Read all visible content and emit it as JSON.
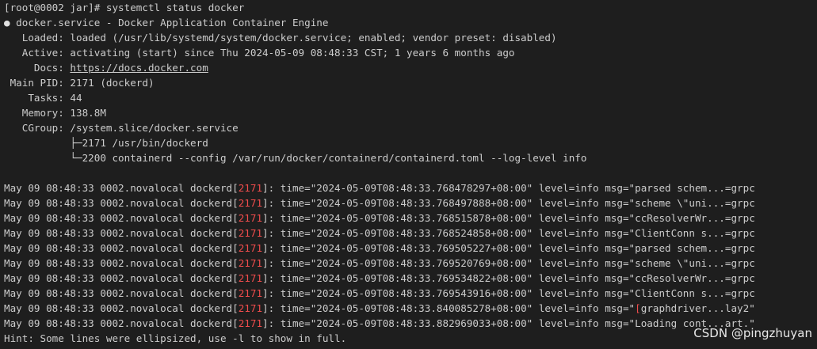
{
  "prompt": "[root@0002 jar]# systemctl status docker",
  "service": {
    "bullet": "●",
    "line": " docker.service - Docker Application Container Engine"
  },
  "fields": [
    {
      "label": "   Loaded: ",
      "value": "loaded (/usr/lib/systemd/system/docker.service; enabled; vendor preset: disabled)"
    },
    {
      "label": "   Active: ",
      "value": "activating (start) since Thu 2024-05-09 08:48:33 CST; 1 years 6 months ago"
    },
    {
      "label": "     Docs: ",
      "value": "https://docs.docker.com"
    },
    {
      "label": " Main PID: ",
      "value": "2171 (dockerd)"
    },
    {
      "label": "    Tasks: ",
      "value": "44"
    },
    {
      "label": "   Memory: ",
      "value": "138.8M"
    },
    {
      "label": "   CGroup: ",
      "value": "/system.slice/docker.service"
    }
  ],
  "cgroup_tree": [
    "           ├─2171 /usr/bin/dockerd",
    "           └─2200 containerd --config /var/run/docker/containerd/containerd.toml --log-level info"
  ],
  "logs": [
    {
      "prefix": "May 09 08:48:33 0002.novalocal dockerd[",
      "pid": "2171",
      "suffix": "]: time=\"2024-05-09T08:48:33.768478297+08:00\" level=info msg=\"parsed schem...=grpc",
      "bracket": "",
      "tail": ""
    },
    {
      "prefix": "May 09 08:48:33 0002.novalocal dockerd[",
      "pid": "2171",
      "suffix": "]: time=\"2024-05-09T08:48:33.768497888+08:00\" level=info msg=\"scheme \\\"uni...=grpc",
      "bracket": "",
      "tail": ""
    },
    {
      "prefix": "May 09 08:48:33 0002.novalocal dockerd[",
      "pid": "2171",
      "suffix": "]: time=\"2024-05-09T08:48:33.768515878+08:00\" level=info msg=\"ccResolverWr...=grpc",
      "bracket": "",
      "tail": ""
    },
    {
      "prefix": "May 09 08:48:33 0002.novalocal dockerd[",
      "pid": "2171",
      "suffix": "]: time=\"2024-05-09T08:48:33.768524858+08:00\" level=info msg=\"ClientConn s...=grpc",
      "bracket": "",
      "tail": ""
    },
    {
      "prefix": "May 09 08:48:33 0002.novalocal dockerd[",
      "pid": "2171",
      "suffix": "]: time=\"2024-05-09T08:48:33.769505227+08:00\" level=info msg=\"parsed schem...=grpc",
      "bracket": "",
      "tail": ""
    },
    {
      "prefix": "May 09 08:48:33 0002.novalocal dockerd[",
      "pid": "2171",
      "suffix": "]: time=\"2024-05-09T08:48:33.769520769+08:00\" level=info msg=\"scheme \\\"uni...=grpc",
      "bracket": "",
      "tail": ""
    },
    {
      "prefix": "May 09 08:48:33 0002.novalocal dockerd[",
      "pid": "2171",
      "suffix": "]: time=\"2024-05-09T08:48:33.769534822+08:00\" level=info msg=\"ccResolverWr...=grpc",
      "bracket": "",
      "tail": ""
    },
    {
      "prefix": "May 09 08:48:33 0002.novalocal dockerd[",
      "pid": "2171",
      "suffix": "]: time=\"2024-05-09T08:48:33.769543916+08:00\" level=info msg=\"ClientConn s...=grpc",
      "bracket": "",
      "tail": ""
    },
    {
      "prefix": "May 09 08:48:33 0002.novalocal dockerd[",
      "pid": "2171",
      "suffix": "]: time=\"2024-05-09T08:48:33.840085278+08:00\" level=info msg=\"",
      "bracket": "[",
      "tail": "graphdriver...lay2\""
    },
    {
      "prefix": "May 09 08:48:33 0002.novalocal dockerd[",
      "pid": "2171",
      "suffix": "]: time=\"2024-05-09T08:48:33.882969033+08:00\" level=info msg=\"Loading cont...art.\"",
      "bracket": "",
      "tail": ""
    }
  ],
  "hint": "Hint: Some lines were ellipsized, use -l to show in full.",
  "watermark": "CSDN @pingzhuyan",
  "colors": {
    "background": "#1e1e1e",
    "text": "#cccccc",
    "pid_highlight": "#f14c4c"
  }
}
